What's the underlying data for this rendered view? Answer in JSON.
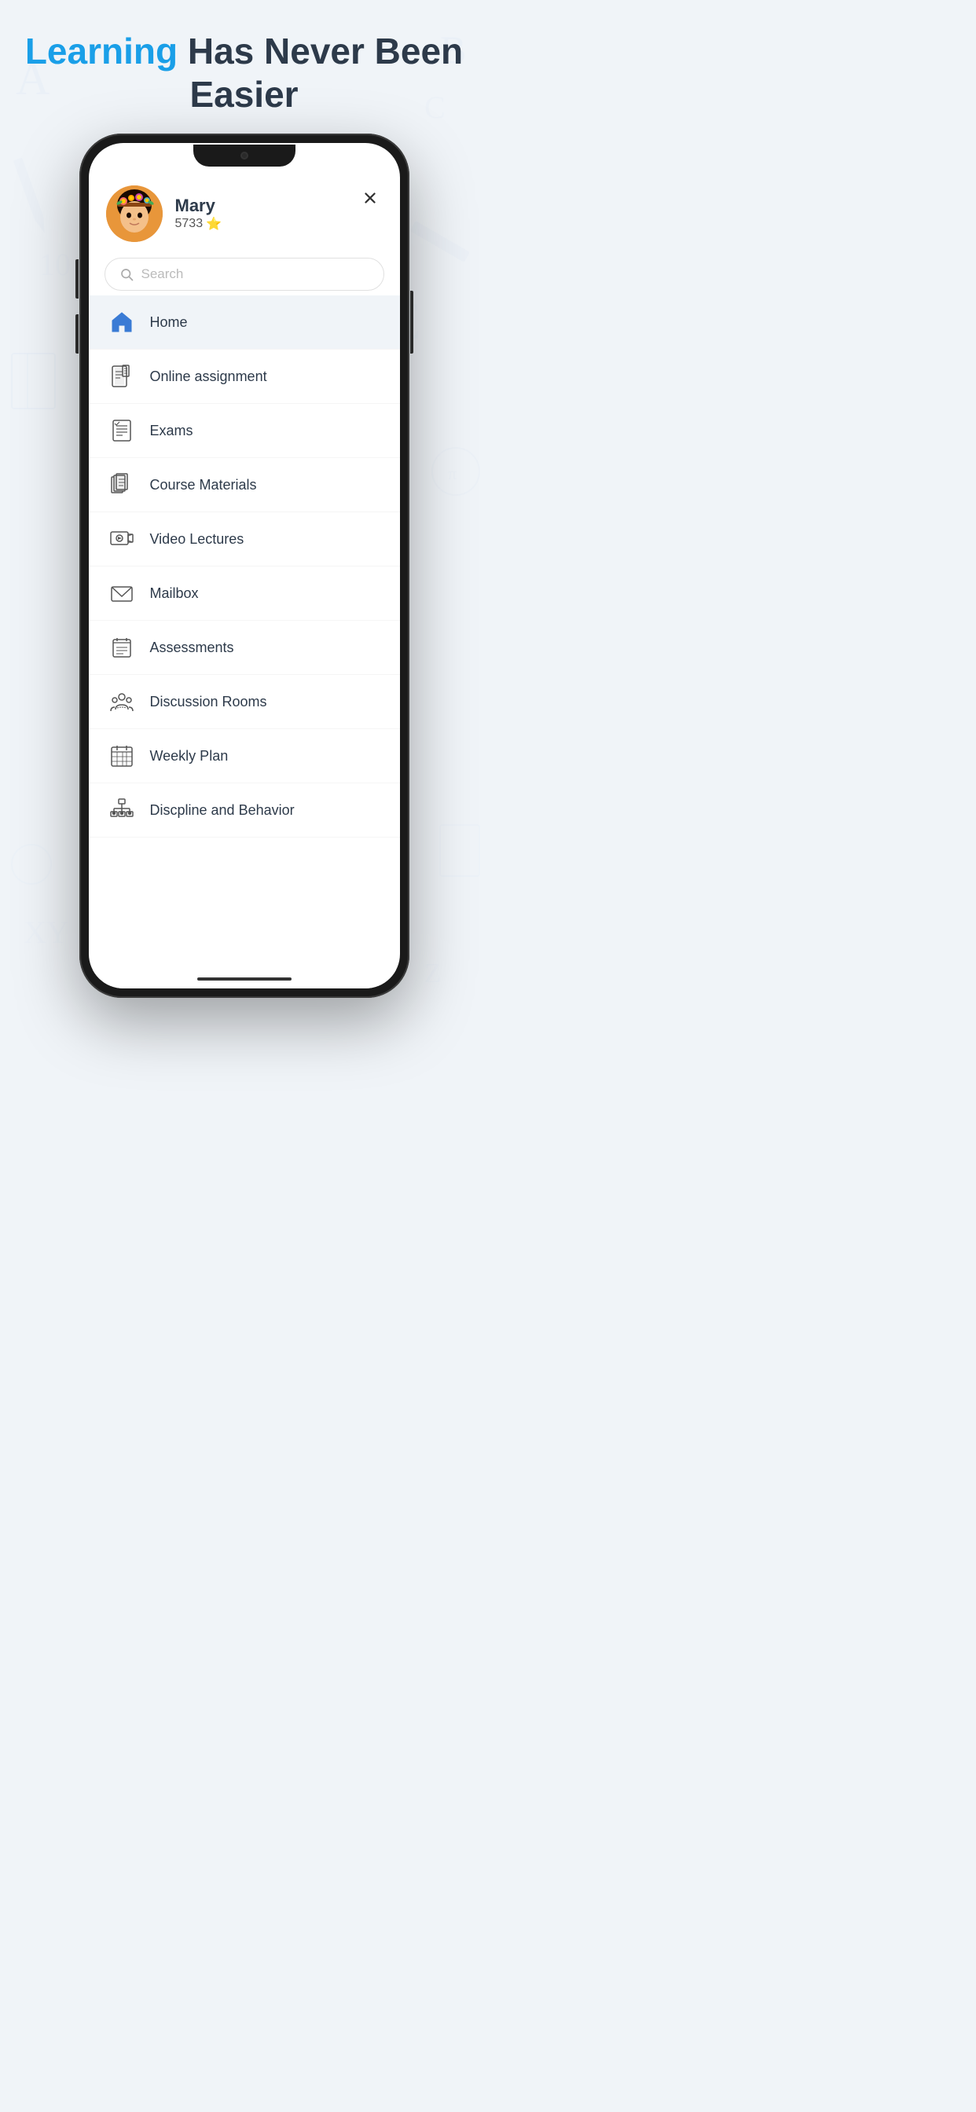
{
  "page": {
    "background_color": "#eef2f6"
  },
  "hero": {
    "learning_text": "Learning",
    "rest_text": " Has Never Been Easier"
  },
  "close_button_label": "×",
  "user": {
    "name": "Mary",
    "points": "5733",
    "star": "⭐"
  },
  "search": {
    "placeholder": "Search"
  },
  "menu_items": [
    {
      "id": "home",
      "label": "Home",
      "active": true
    },
    {
      "id": "online-assignment",
      "label": "Online assignment",
      "active": false
    },
    {
      "id": "exams",
      "label": "Exams",
      "active": false
    },
    {
      "id": "course-materials",
      "label": "Course Materials",
      "active": false
    },
    {
      "id": "video-lectures",
      "label": "Video Lectures",
      "active": false
    },
    {
      "id": "mailbox",
      "label": "Mailbox",
      "active": false
    },
    {
      "id": "assessments",
      "label": "Assessments",
      "active": false
    },
    {
      "id": "discussion-rooms",
      "label": "Discussion Rooms",
      "active": false
    },
    {
      "id": "weekly-plan",
      "label": "Weekly Plan",
      "active": false
    },
    {
      "id": "discipline-behavior",
      "label": "Discpline and Behavior",
      "active": false
    }
  ]
}
